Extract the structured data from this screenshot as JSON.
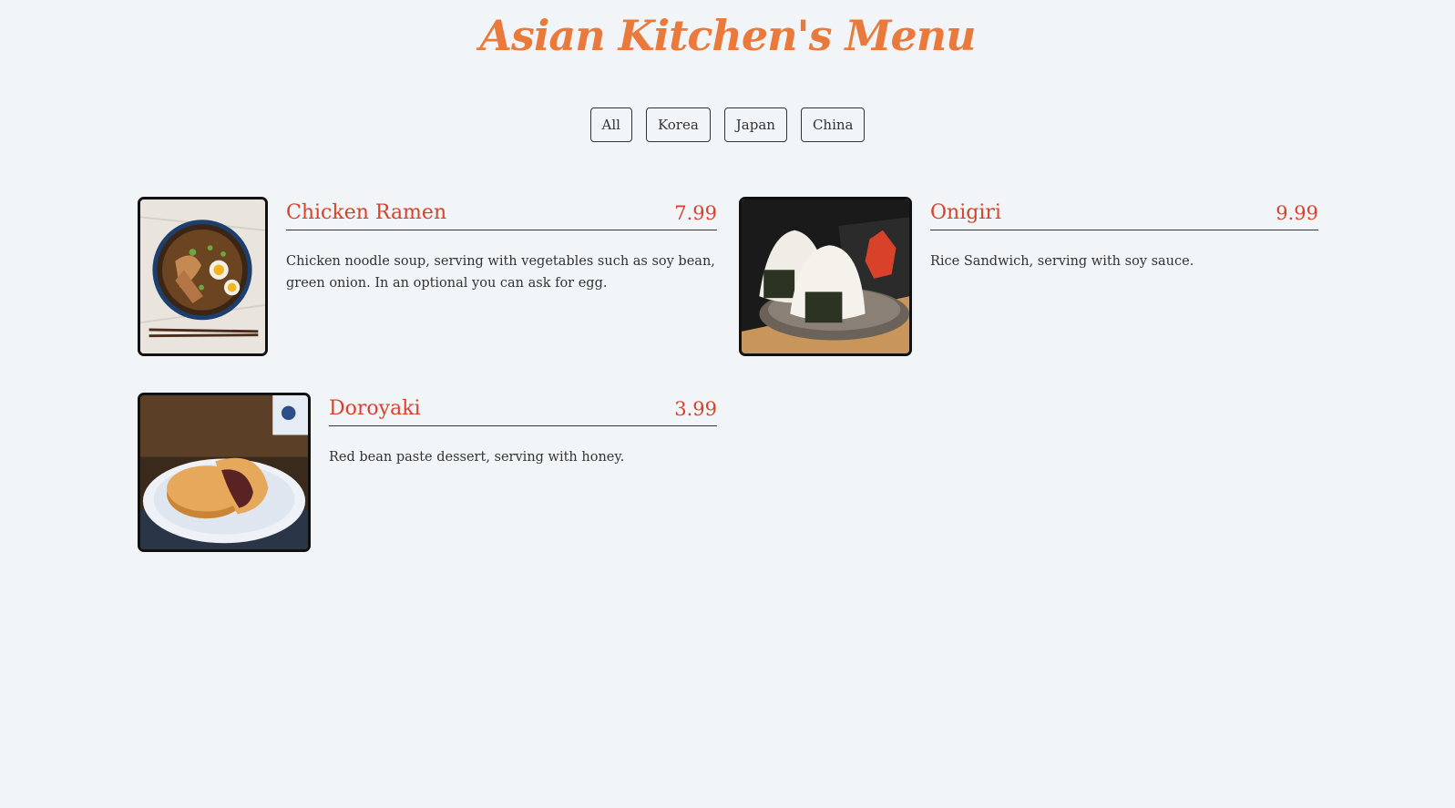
{
  "page": {
    "title": "Asian Kitchen's Menu"
  },
  "filters": [
    "All",
    "Korea",
    "Japan",
    "China"
  ],
  "menu": [
    {
      "name": "Chicken Ramen",
      "price": "7.99",
      "description": "Chicken noodle soup, serving with vegetables such as soy bean, green onion. In an optional you can ask for egg.",
      "image": "ramen-bowl"
    },
    {
      "name": "Onigiri",
      "price": "9.99",
      "description": "Rice Sandwich, serving with soy sauce.",
      "image": "rice-balls"
    },
    {
      "name": "Doroyaki",
      "price": "3.99",
      "description": "Red bean paste dessert, serving with honey.",
      "image": "dorayaki-plate"
    }
  ],
  "colors": {
    "background": "#f1f5f8",
    "title": "#ea7a3c",
    "accent": "#d8412a"
  }
}
